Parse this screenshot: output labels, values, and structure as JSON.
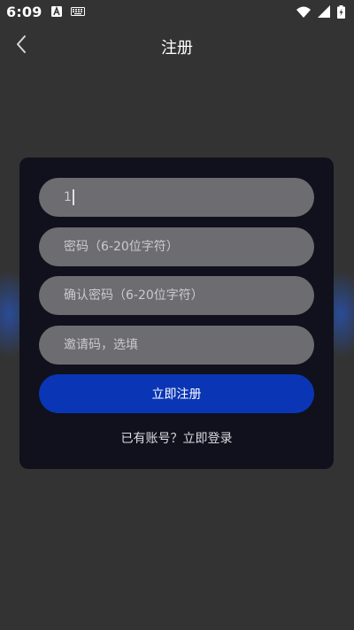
{
  "status_bar": {
    "time": "6:09",
    "icons": [
      "font-a-icon",
      "keyboard-icon",
      "wifi-icon",
      "signal-icon",
      "battery-charging-icon"
    ]
  },
  "app_bar": {
    "title": "注册",
    "back_icon": "chevron-left-icon"
  },
  "form": {
    "fields": [
      {
        "value": "1",
        "placeholder": ""
      },
      {
        "value": "",
        "placeholder": "密码（6-20位字符）"
      },
      {
        "value": "",
        "placeholder": "确认密码（6-20位字符）"
      },
      {
        "value": "",
        "placeholder": "邀请码，选填"
      }
    ],
    "submit_label": "立即注册",
    "login_link": "已有账号？立即登录"
  },
  "colors": {
    "background": "#333333",
    "card": "#10111c",
    "field": "#6c6c71",
    "primary": "#0a36b5"
  }
}
